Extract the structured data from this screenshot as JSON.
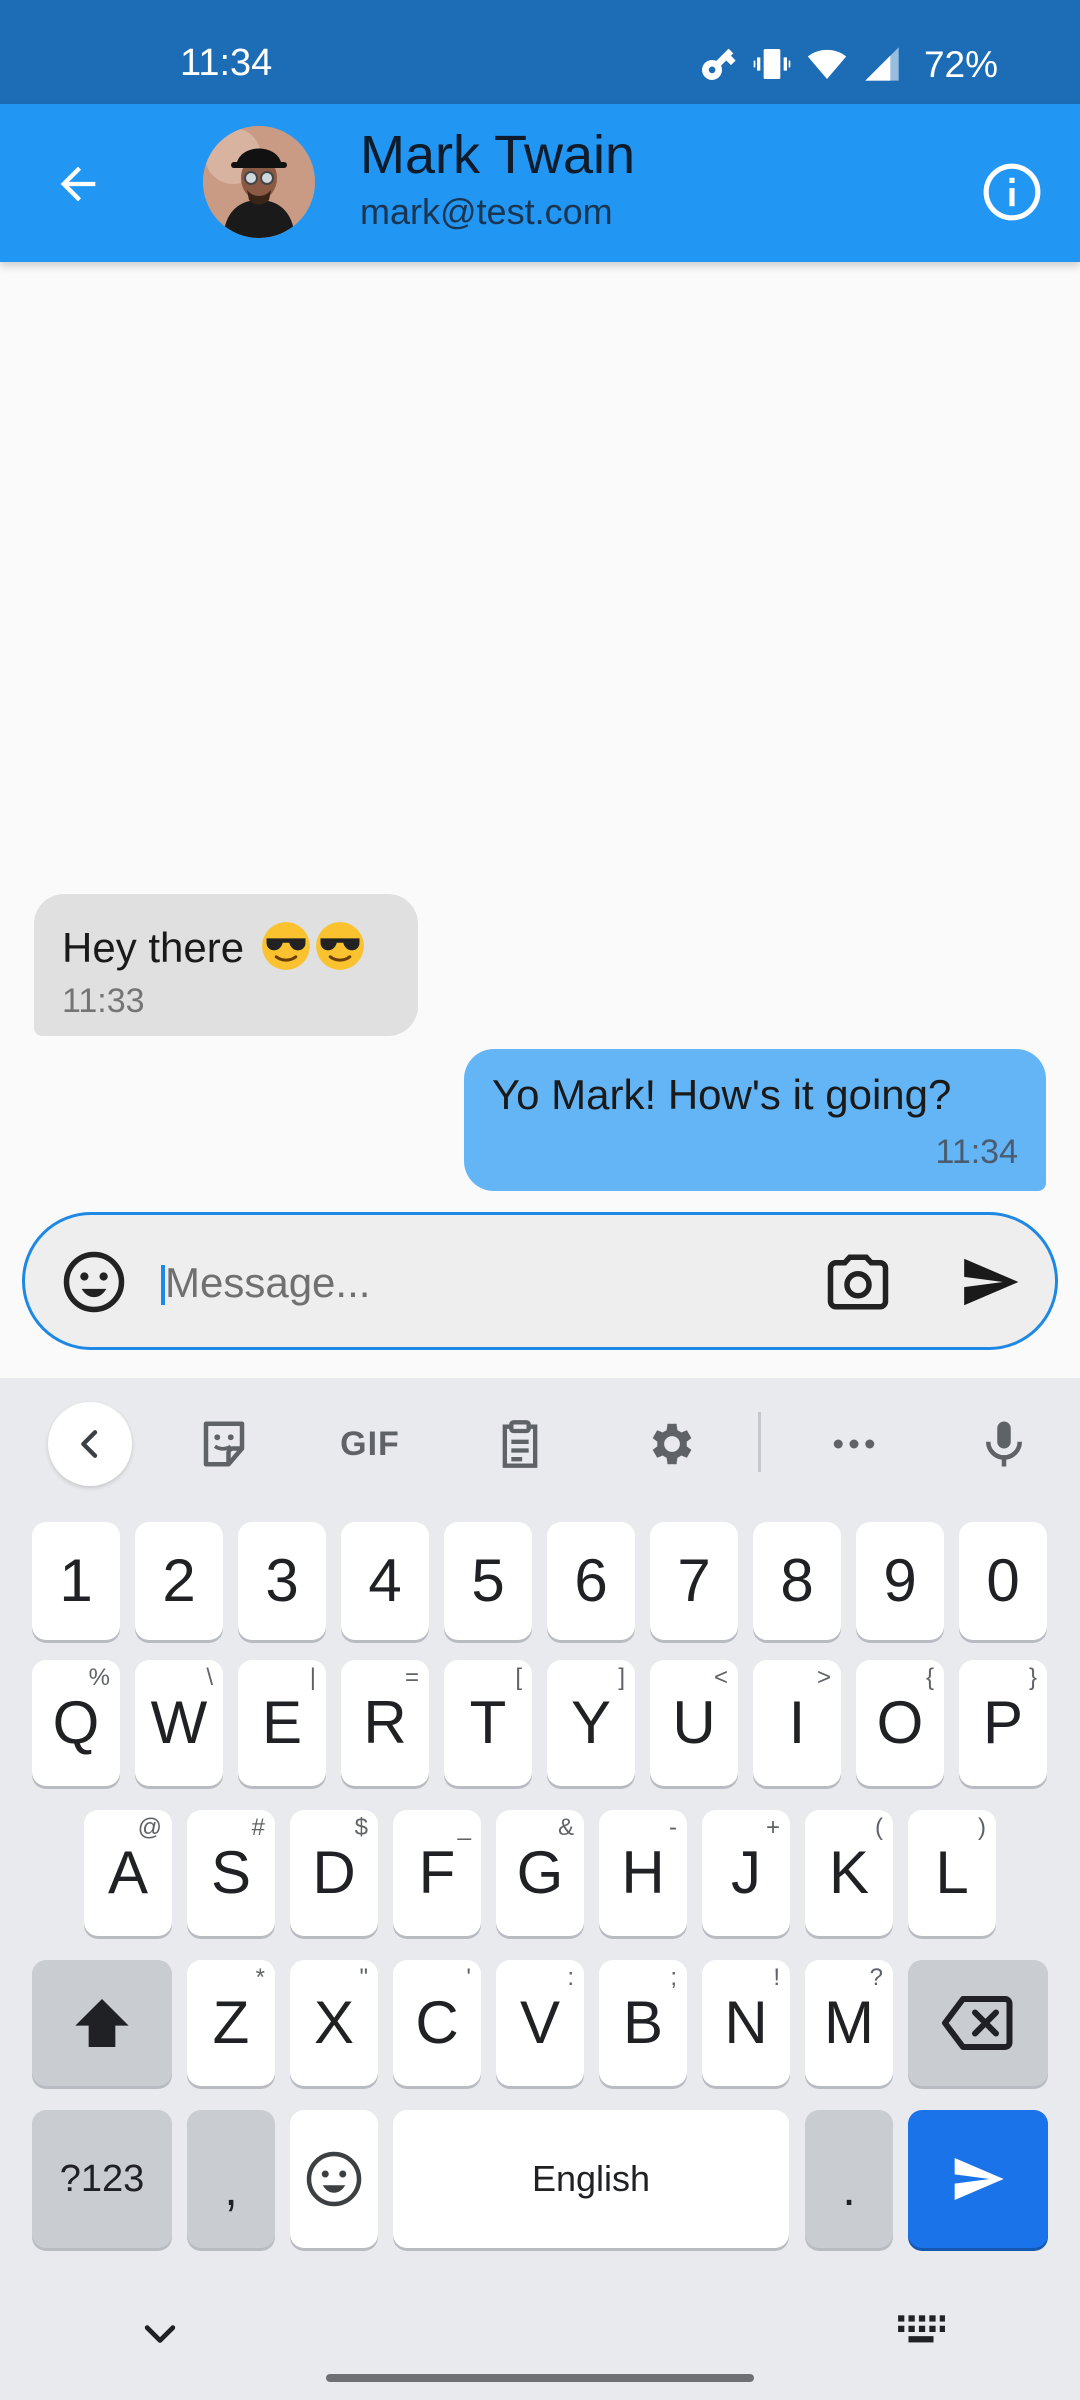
{
  "status_bar": {
    "time": "11:34",
    "battery": "72%",
    "icons": [
      "key-icon",
      "vibrate-icon",
      "wifi-icon",
      "signal-icon"
    ]
  },
  "header": {
    "contact_name": "Mark Twain",
    "contact_email": "mark@test.com",
    "back_icon": "arrow-back-icon",
    "info_icon": "info-icon"
  },
  "messages": [
    {
      "direction": "incoming",
      "text": "Hey there",
      "emoji": "😎😎",
      "time": "11:33"
    },
    {
      "direction": "outgoing",
      "text": "Yo Mark! How's it going?",
      "time": "11:34"
    }
  ],
  "composer": {
    "placeholder": "Message...",
    "value": ""
  },
  "keyboard": {
    "toolbar": [
      "chevron-left-icon",
      "sticker-icon",
      "GIF",
      "clipboard-icon",
      "settings-icon",
      "more-icon",
      "mic-icon"
    ],
    "gif_label": "GIF",
    "number_row": [
      "1",
      "2",
      "3",
      "4",
      "5",
      "6",
      "7",
      "8",
      "9",
      "0"
    ],
    "row1": [
      {
        "key": "Q",
        "hint": "%"
      },
      {
        "key": "W",
        "hint": "\\"
      },
      {
        "key": "E",
        "hint": "|"
      },
      {
        "key": "R",
        "hint": "="
      },
      {
        "key": "T",
        "hint": "["
      },
      {
        "key": "Y",
        "hint": "]"
      },
      {
        "key": "U",
        "hint": "<"
      },
      {
        "key": "I",
        "hint": ">"
      },
      {
        "key": "O",
        "hint": "{"
      },
      {
        "key": "P",
        "hint": "}"
      }
    ],
    "row2": [
      {
        "key": "A",
        "hint": "@"
      },
      {
        "key": "S",
        "hint": "#"
      },
      {
        "key": "D",
        "hint": "$"
      },
      {
        "key": "F",
        "hint": "_"
      },
      {
        "key": "G",
        "hint": "&"
      },
      {
        "key": "H",
        "hint": "-"
      },
      {
        "key": "J",
        "hint": "+"
      },
      {
        "key": "K",
        "hint": "("
      },
      {
        "key": "L",
        "hint": ")"
      }
    ],
    "row3": [
      {
        "key": "Z",
        "hint": "*"
      },
      {
        "key": "X",
        "hint": "\""
      },
      {
        "key": "C",
        "hint": "'"
      },
      {
        "key": "V",
        "hint": ":"
      },
      {
        "key": "B",
        "hint": ";"
      },
      {
        "key": "N",
        "hint": "!"
      },
      {
        "key": "M",
        "hint": "?"
      }
    ],
    "symbols_label": "?123",
    "comma": ",",
    "space_label": "English",
    "period": ".",
    "shift_icon": "shift-icon",
    "backspace_icon": "backspace-icon",
    "enter_icon": "send-icon"
  },
  "colors": {
    "status_bar": "#1c6db5",
    "app_bar": "#2196f3",
    "incoming_bubble": "#e0e0e0",
    "outgoing_bubble": "#64b5f6",
    "accent": "#1e88e5",
    "keyboard_enter": "#1a73e8"
  }
}
